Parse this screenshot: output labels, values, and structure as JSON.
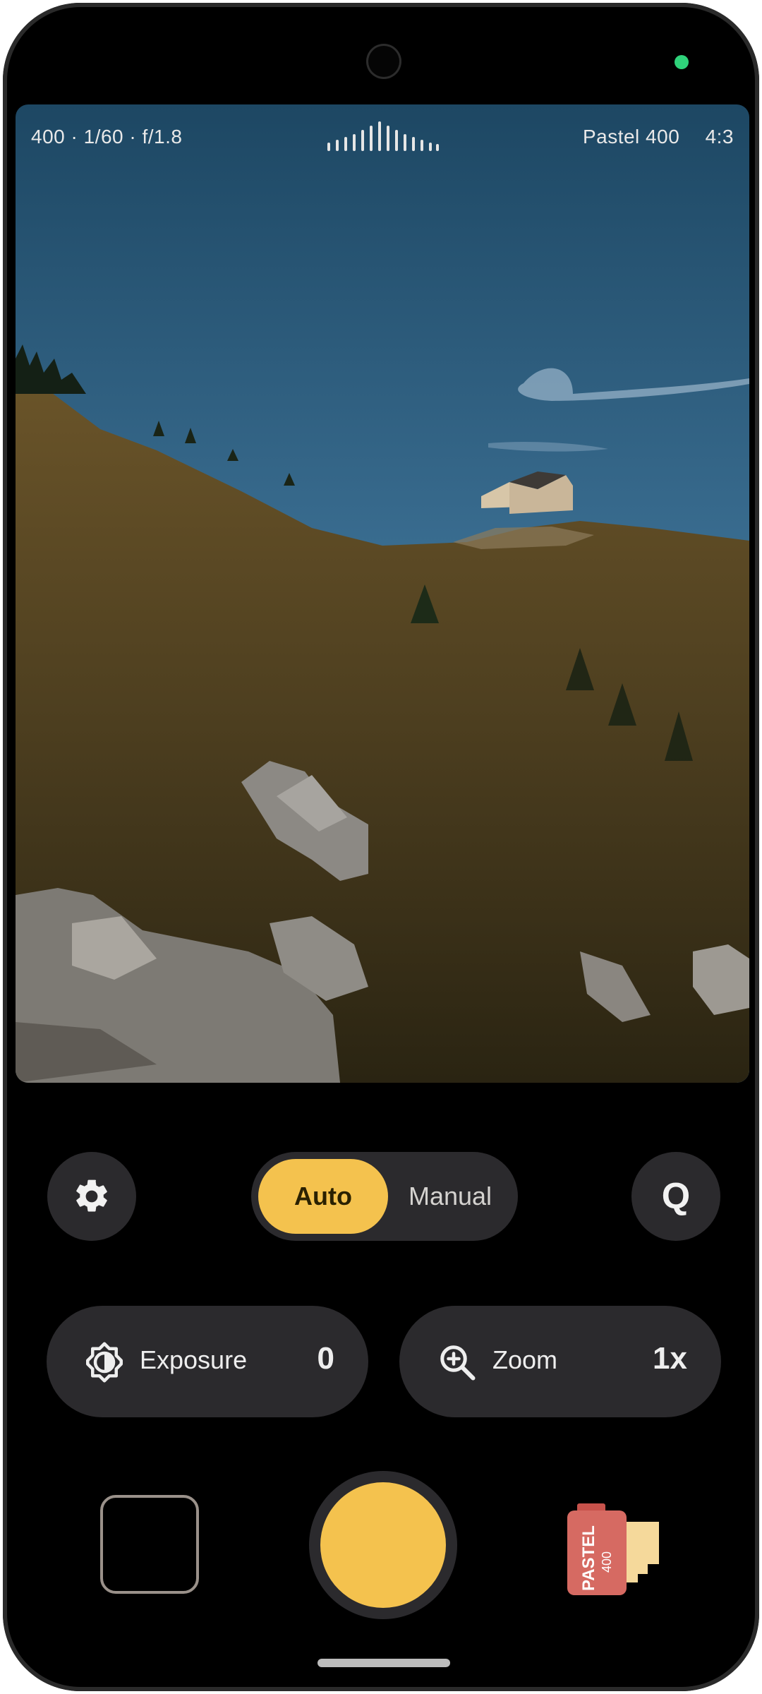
{
  "viewfinder": {
    "settings_readout": "400 · 1/60 · f/1.8",
    "film_name": "Pastel 400",
    "aspect_ratio": "4:3"
  },
  "mode_toggle": {
    "options": [
      "Auto",
      "Manual"
    ],
    "selected": "Auto"
  },
  "quick_button": {
    "label": "Q"
  },
  "exposure": {
    "label": "Exposure",
    "value": "0"
  },
  "zoom": {
    "label": "Zoom",
    "value": "1x"
  },
  "film_canister": {
    "brand": "PASTEL",
    "iso": "400"
  },
  "colors": {
    "accent": "#f4c24e",
    "control_bg": "#2b2a2d",
    "background": "#000000",
    "privacy_indicator": "#2fd27a",
    "film_canister": "#d66a62"
  },
  "icons": {
    "settings": "gear-icon",
    "exposure": "exposure-icon",
    "zoom": "zoom-in-icon",
    "film": "film-canister-icon"
  }
}
